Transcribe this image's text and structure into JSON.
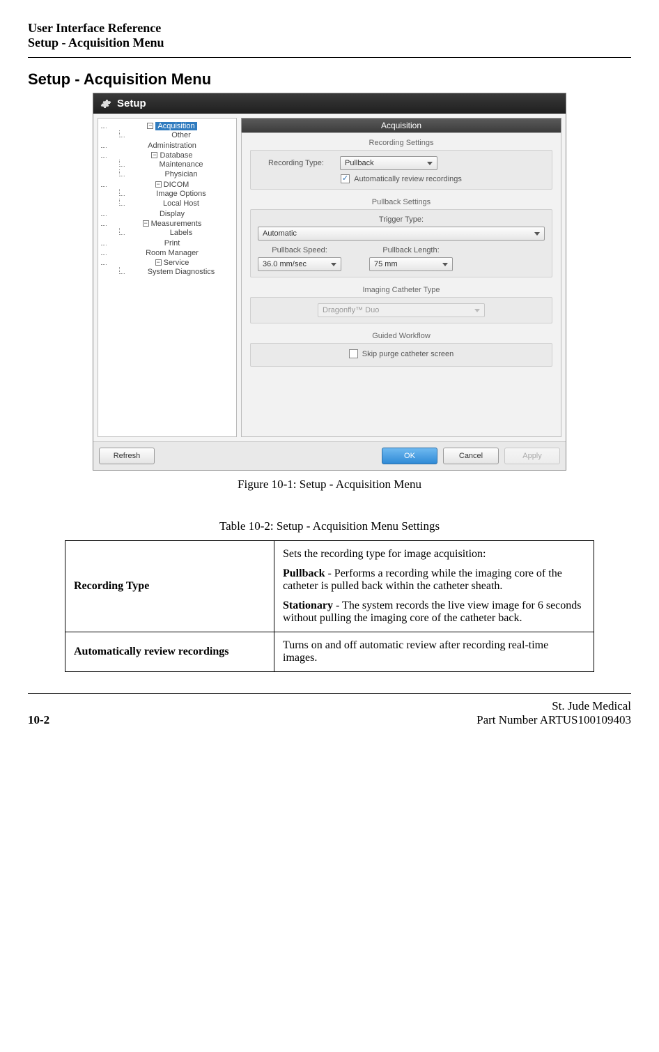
{
  "page_header": {
    "line1": "User Interface Reference",
    "line2": "Setup - Acquisition Menu"
  },
  "section_title": "Setup - Acquisition Menu",
  "setup_window": {
    "title": "Setup",
    "tree": {
      "acquisition": "Acquisition",
      "acquisition_children": {
        "other": "Other"
      },
      "administration": "Administration",
      "database": "Database",
      "database_children": {
        "maintenance": "Maintenance",
        "physician": "Physician"
      },
      "dicom": "DICOM",
      "dicom_children": {
        "image_options": "Image Options",
        "local_host": "Local Host"
      },
      "display": "Display",
      "measurements": "Measurements",
      "measurements_children": {
        "labels": "Labels"
      },
      "print": "Print",
      "room_manager": "Room Manager",
      "service": "Service",
      "service_children": {
        "system_diagnostics": "System Diagnostics"
      }
    },
    "content": {
      "pane_title": "Acquisition",
      "recording_settings": {
        "group_title": "Recording Settings",
        "recording_type_label": "Recording Type:",
        "recording_type_value": "Pullback",
        "auto_review_label": "Automatically review recordings",
        "auto_review_checked": true
      },
      "pullback_settings": {
        "group_title": "Pullback Settings",
        "trigger_type_label": "Trigger Type:",
        "trigger_type_value": "Automatic",
        "pullback_speed_label": "Pullback Speed:",
        "pullback_speed_value": "36.0 mm/sec",
        "pullback_length_label": "Pullback Length:",
        "pullback_length_value": "75 mm"
      },
      "imaging_catheter": {
        "group_title": "Imaging Catheter Type",
        "value": "Dragonfly™ Duo"
      },
      "guided_workflow": {
        "group_title": "Guided Workflow",
        "skip_purge_label": "Skip purge catheter screen",
        "skip_purge_checked": false
      }
    },
    "buttons": {
      "refresh": "Refresh",
      "ok": "OK",
      "cancel": "Cancel",
      "apply": "Apply"
    }
  },
  "figure_caption": "Figure 10-1:  Setup - Acquisition Menu",
  "table_caption": "Table 10-2:  Setup - Acquisition Menu Settings",
  "settings_table": {
    "row1": {
      "key": "Recording Type",
      "intro": "Sets the recording type for image acquisition:",
      "pullback_term": "Pullback",
      "pullback_desc": " - Performs a recording while the imaging core of the catheter is pulled back within the catheter sheath.",
      "stationary_term": "Stationary",
      "stationary_desc": " - The system records the live view image for 6 seconds without pulling the imaging core of the catheter back."
    },
    "row2": {
      "key": "Automatically review recordings",
      "desc": "Turns on and off automatic review after recording real-time images."
    }
  },
  "footer": {
    "page": "10-2",
    "company": "St. Jude Medical",
    "part": "Part Number ARTUS100109403"
  }
}
